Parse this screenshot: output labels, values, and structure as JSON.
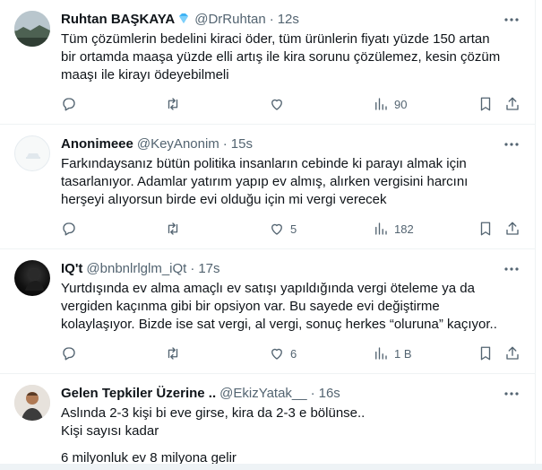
{
  "tweets": [
    {
      "name": "Ruhtan BAŞKAYA",
      "verified_icon": "diamond-icon",
      "handle": "@DrRuhtan",
      "time": "12s",
      "lines": [
        "Tüm çözümlerin bedelini kiraci öder, tüm ürünlerin fiyatı yüzde 150 artan",
        "bir ortamda maaşa yüzde elli artış ile kira sorunu çözülemez, kesin çözüm",
        "maaşı ile kirayı ödeyebilmeli"
      ],
      "reply_count": "",
      "retweet_count": "",
      "like_count": "",
      "view_count": "90"
    },
    {
      "name": "Anonimeee",
      "handle": "@KeyAnonim",
      "time": "15s",
      "lines": [
        "Farkındaysanız bütün politika insanların cebinde ki parayı almak için",
        "tasarlanıyor. Adamlar yatırım yapıp ev almış, alırken vergisini harcını",
        "herşeyi alıyorsun birde evi olduğu için mi vergi verecek"
      ],
      "reply_count": "",
      "retweet_count": "",
      "like_count": "5",
      "view_count": "182"
    },
    {
      "name": "IQ't",
      "handle": "@bnbnlrlglm_iQt",
      "time": "17s",
      "lines": [
        "Yurtdışında ev alma amaçlı ev satışı yapıldığında vergi öteleme ya da",
        "vergiden kaçınma gibi bir opsiyon var. Bu sayede evi değiştirme",
        "kolaylaşıyor. Bizde ise sat vergi, al vergi, sonuç herkes “oluruna” kaçıyor.."
      ],
      "reply_count": "",
      "retweet_count": "",
      "like_count": "6",
      "view_count": "1 B"
    },
    {
      "name": "Gelen Tepkiler Üzerine ..",
      "handle": "@EkizYatak__",
      "time": "16s",
      "lines": [
        "Aslında 2-3 kişi bi eve girse, kira da 2-3 e bölünse..",
        "Kişi sayısı kadar",
        "6 milyonluk ev 8 milyona gelir"
      ]
    }
  ],
  "colors": {
    "text": "#0f1419",
    "secondary": "#536471",
    "divider": "#eff3f4",
    "verified": "#3fb3f5"
  }
}
